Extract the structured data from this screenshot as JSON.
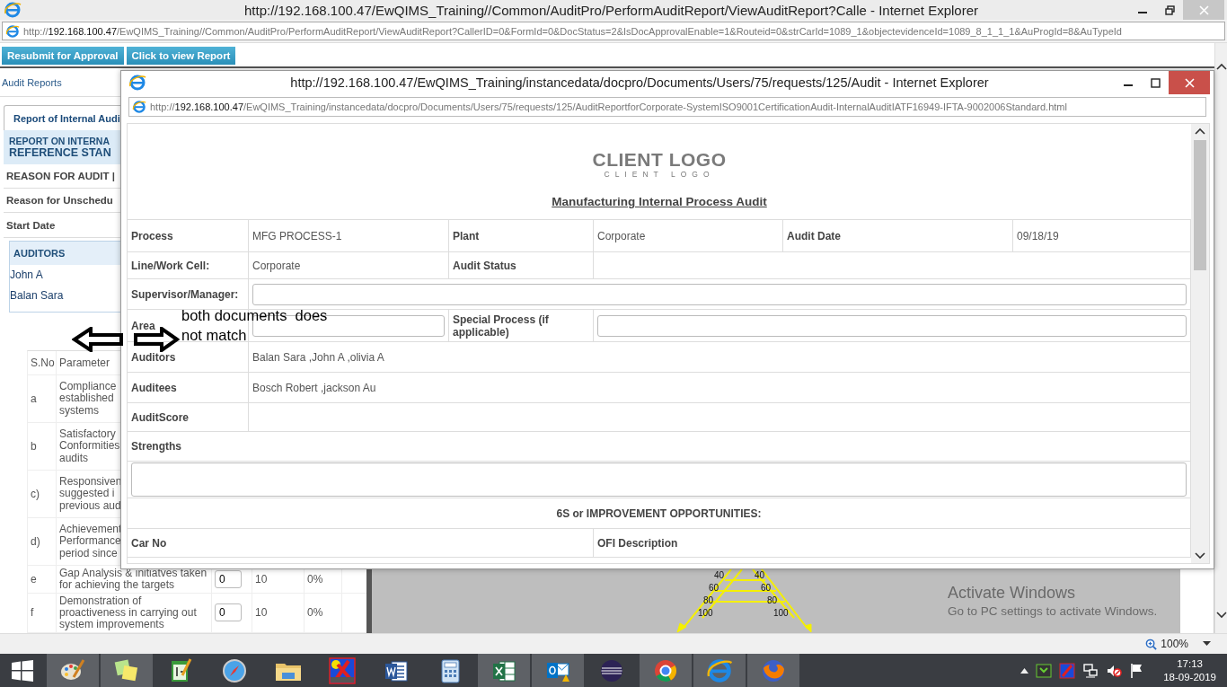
{
  "window": {
    "title": "http://192.168.100.47/EwQIMS_Training//Common/AuditPro/PerformAuditReport/ViewAuditReport?Calle - Internet Explorer",
    "address": "http://**192.168.100.47**/EwQIMS_Training//Common/AuditPro/PerformAuditReport/ViewAuditReport?CallerID=0&FormId=0&DocStatus=2&IsDocApprovalEnable=1&Routeid=0&strCarId=1089_1&objectevidenceId=1089_8_1_1_1&AuProgId=8&AuTypeId"
  },
  "toolbar": [
    "Resubmit for Approval",
    "Click to view Report"
  ],
  "breadcrumb": "Audit Reports",
  "tabs": [
    {
      "label": "Report of Internal Audi",
      "selected": true
    }
  ],
  "report_heading": [
    "REPORT ON INTERNA",
    "REFERENCE STAN"
  ],
  "report_rows": [
    "REASON FOR AUDIT |",
    "Reason for Unschedu",
    "Start Date"
  ],
  "auditors": {
    "heading": "AUDITORS",
    "names": [
      "John A",
      "Balan Sara"
    ]
  },
  "parameters": {
    "columns": [
      "S.No",
      "Parameter"
    ],
    "rows": [
      {
        "sno": "a",
        "text": "Compliance\nestablished\nsystems"
      },
      {
        "sno": "b",
        "text": "Satisfactory\nConformities\naudits"
      },
      {
        "sno": "c)",
        "text": "Responsiven\nsuggested i\nprevious aud"
      },
      {
        "sno": "d)",
        "text": "Achievement\nPerformance\nperiod since"
      },
      {
        "sno": "e",
        "text": "Gap Analysis & initiatves taken\nfor achieving the targets",
        "score": "0",
        "max": "10",
        "percent": "0%"
      },
      {
        "sno": "f",
        "text": "Demonstration of\nproactiveness in carrying out\nsystem improvements",
        "score": "0",
        "max": "10",
        "percent": "0%"
      }
    ]
  },
  "gauge": {
    "left_labels": [
      "40",
      "60",
      "80",
      "100"
    ],
    "right_labels": [
      "40",
      "60",
      "80",
      "100"
    ]
  },
  "popup": {
    "title": "http://192.168.100.47/EwQIMS_Training/instancedata/docpro/Documents/Users/75/requests/125/Audit - Internet Explorer",
    "address": "http://**192.168.100.47**/EwQIMS_Training/instancedata/docpro/Documents/Users/75/requests/125/AuditReportforCorporate-SystemISO9001CertificationAudit-InternalAuditIATF16949-IFTA-9002006Standard.html",
    "logo": {
      "main": "CLIENT LOGO",
      "sub": "CLIENT LOGO"
    },
    "heading": "Manufacturing Internal Process Audit",
    "rows": [
      {
        "kind": "fields",
        "cells": [
          {
            "kind": "label",
            "text": "Process"
          },
          {
            "kind": "value",
            "text": "MFG PROCESS-1"
          },
          {
            "kind": "label",
            "text": "Plant"
          },
          {
            "kind": "value",
            "text": "Corporate"
          },
          {
            "kind": "label",
            "text": "Audit Date"
          },
          {
            "kind": "value",
            "text": "09/18/19"
          }
        ]
      },
      {
        "kind": "fields",
        "cells": [
          {
            "kind": "label",
            "text": "Line/Work Cell:"
          },
          {
            "kind": "value",
            "text": "Corporate"
          },
          {
            "kind": "label",
            "text": "Audit Status"
          }
        ]
      },
      {
        "kind": "fields",
        "cells": [
          {
            "kind": "label",
            "text": "Supervisor/Manager:"
          },
          {
            "kind": "input"
          }
        ]
      },
      {
        "kind": "fields",
        "cells": [
          {
            "kind": "label",
            "text": "Area"
          },
          {
            "kind": "input"
          },
          {
            "kind": "label",
            "text": "Special Process (if applicable)"
          },
          {
            "kind": "input"
          }
        ]
      },
      {
        "kind": "fields",
        "cells": [
          {
            "kind": "label",
            "text": "Auditors"
          },
          {
            "kind": "value",
            "text": "Balan Sara ,John A ,olivia A"
          }
        ]
      },
      {
        "kind": "fields",
        "cells": [
          {
            "kind": "label",
            "text": "Auditees"
          },
          {
            "kind": "value",
            "text": "Bosch Robert ,jackson Au"
          }
        ]
      },
      {
        "kind": "fields",
        "cells": [
          {
            "kind": "label",
            "text": "AuditScore"
          }
        ]
      },
      {
        "kind": "section",
        "text": "Strengths"
      },
      {
        "kind": "textarea"
      },
      {
        "kind": "banner",
        "text": "6S or IMPROVEMENT OPPORTUNITIES:"
      },
      {
        "kind": "split",
        "cells": [
          {
            "kind": "label",
            "text": "Car No"
          },
          {
            "kind": "label",
            "text": "OFI Description"
          }
        ]
      }
    ]
  },
  "annotation": {
    "text": "both documents  does not match"
  },
  "activation_notice": [
    "Activate Windows",
    "Go to PC settings to activate Windows."
  ],
  "status_bar": {
    "zoom": "100%"
  },
  "taskbar": {
    "apps": [
      {
        "kind": "paint",
        "running": true
      },
      {
        "kind": "notes",
        "running": true
      },
      {
        "kind": "notepad",
        "running": false
      },
      {
        "kind": "compass",
        "running": false
      },
      {
        "kind": "folder",
        "running": false
      },
      {
        "kind": "xapp",
        "running": false
      },
      {
        "kind": "word",
        "running": false
      },
      {
        "kind": "calculator",
        "running": false
      },
      {
        "kind": "excel",
        "running": true
      },
      {
        "kind": "outlook",
        "running": true
      },
      {
        "kind": "eclipse",
        "running": false
      },
      {
        "kind": "chrome",
        "running": true
      },
      {
        "kind": "ie",
        "running": true
      },
      {
        "kind": "firefox",
        "running": true
      }
    ],
    "clock": {
      "time": "17:13",
      "date": "18-09-2019"
    }
  }
}
